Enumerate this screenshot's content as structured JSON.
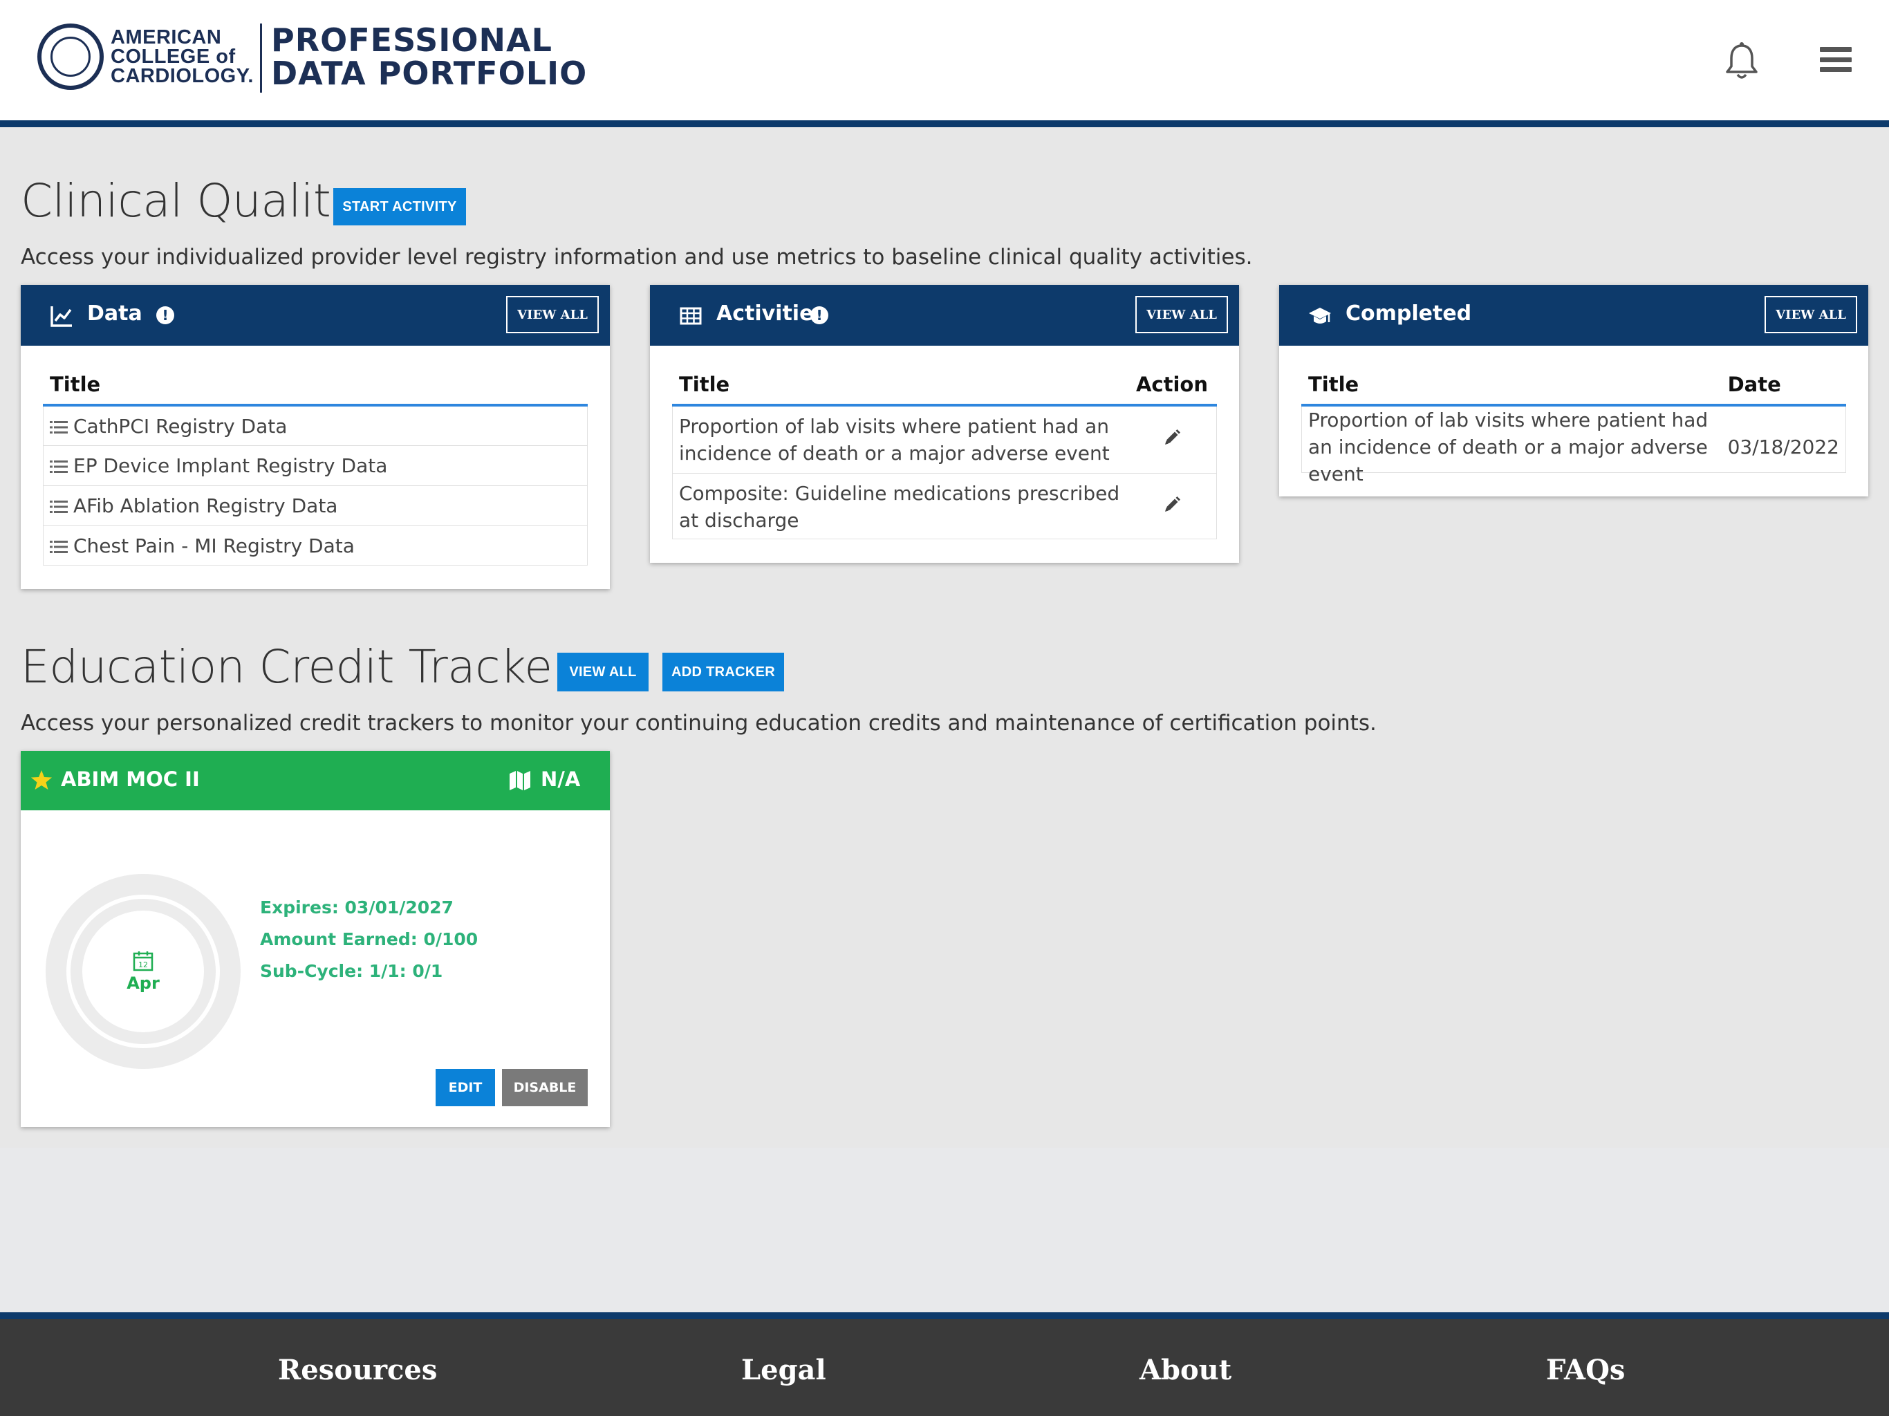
{
  "header": {
    "logo_acc_lines": [
      "AMERICAN",
      "COLLEGE of",
      "CARDIOLOGY."
    ],
    "logo_pdp_lines": [
      "PROFESSIONAL",
      "DATA PORTFOLIO"
    ],
    "icons": [
      "bell-icon",
      "hamburger-menu-icon"
    ]
  },
  "clinical": {
    "title": "Clinical Quality",
    "start_activity_label": "START ACTIVITY",
    "description": "Access your individualized provider level registry information and use metrics to baseline clinical quality activities.",
    "data_card": {
      "title": "Data",
      "info": "!",
      "view_all": "VIEW ALL",
      "column": "Title",
      "items": [
        "CathPCI Registry Data",
        "EP Device Implant Registry Data",
        "AFib Ablation Registry Data",
        "Chest Pain - MI Registry Data"
      ]
    },
    "activities_card": {
      "title": "Activities",
      "info": "!",
      "view_all": "VIEW ALL",
      "columns": [
        "Title",
        "Action"
      ],
      "rows": [
        {
          "title": "Proportion of lab visits where patient had an incidence of death or a major adverse event"
        },
        {
          "title": "Composite: Guideline medications prescribed at discharge"
        }
      ]
    },
    "completed_card": {
      "title": "Completed",
      "view_all": "VIEW ALL",
      "columns": [
        "Title",
        "Date"
      ],
      "rows": [
        {
          "title": "Proportion of lab visits where patient had an incidence of death or a major adverse event",
          "date": "03/18/2022"
        }
      ]
    }
  },
  "education": {
    "title": "Education Credit Trackers",
    "view_all_label": "VIEW ALL",
    "add_tracker_label": "ADD TRACKER",
    "description": "Access your personalized credit trackers to monitor your continuing education credits and maintenance of certification points.",
    "tracker": {
      "title": "ABIM MOC II",
      "status": "N/A",
      "calendar_day": "12",
      "month": "Apr",
      "expires": "Expires: 03/01/2027",
      "amount": "Amount Earned: 0/100",
      "subcycle": "Sub-Cycle: 1/1: 0/1",
      "edit_label": "EDIT",
      "disable_label": "DISABLE",
      "accent_color": "#1fae52"
    }
  },
  "footer": {
    "links": [
      "Resources",
      "Legal",
      "About",
      "FAQs"
    ]
  },
  "colors": {
    "navy": "#0d3a6b",
    "button_blue": "#0b82d8",
    "tracker_green": "#1fae52",
    "footer_bg": "#3a3a3a"
  }
}
